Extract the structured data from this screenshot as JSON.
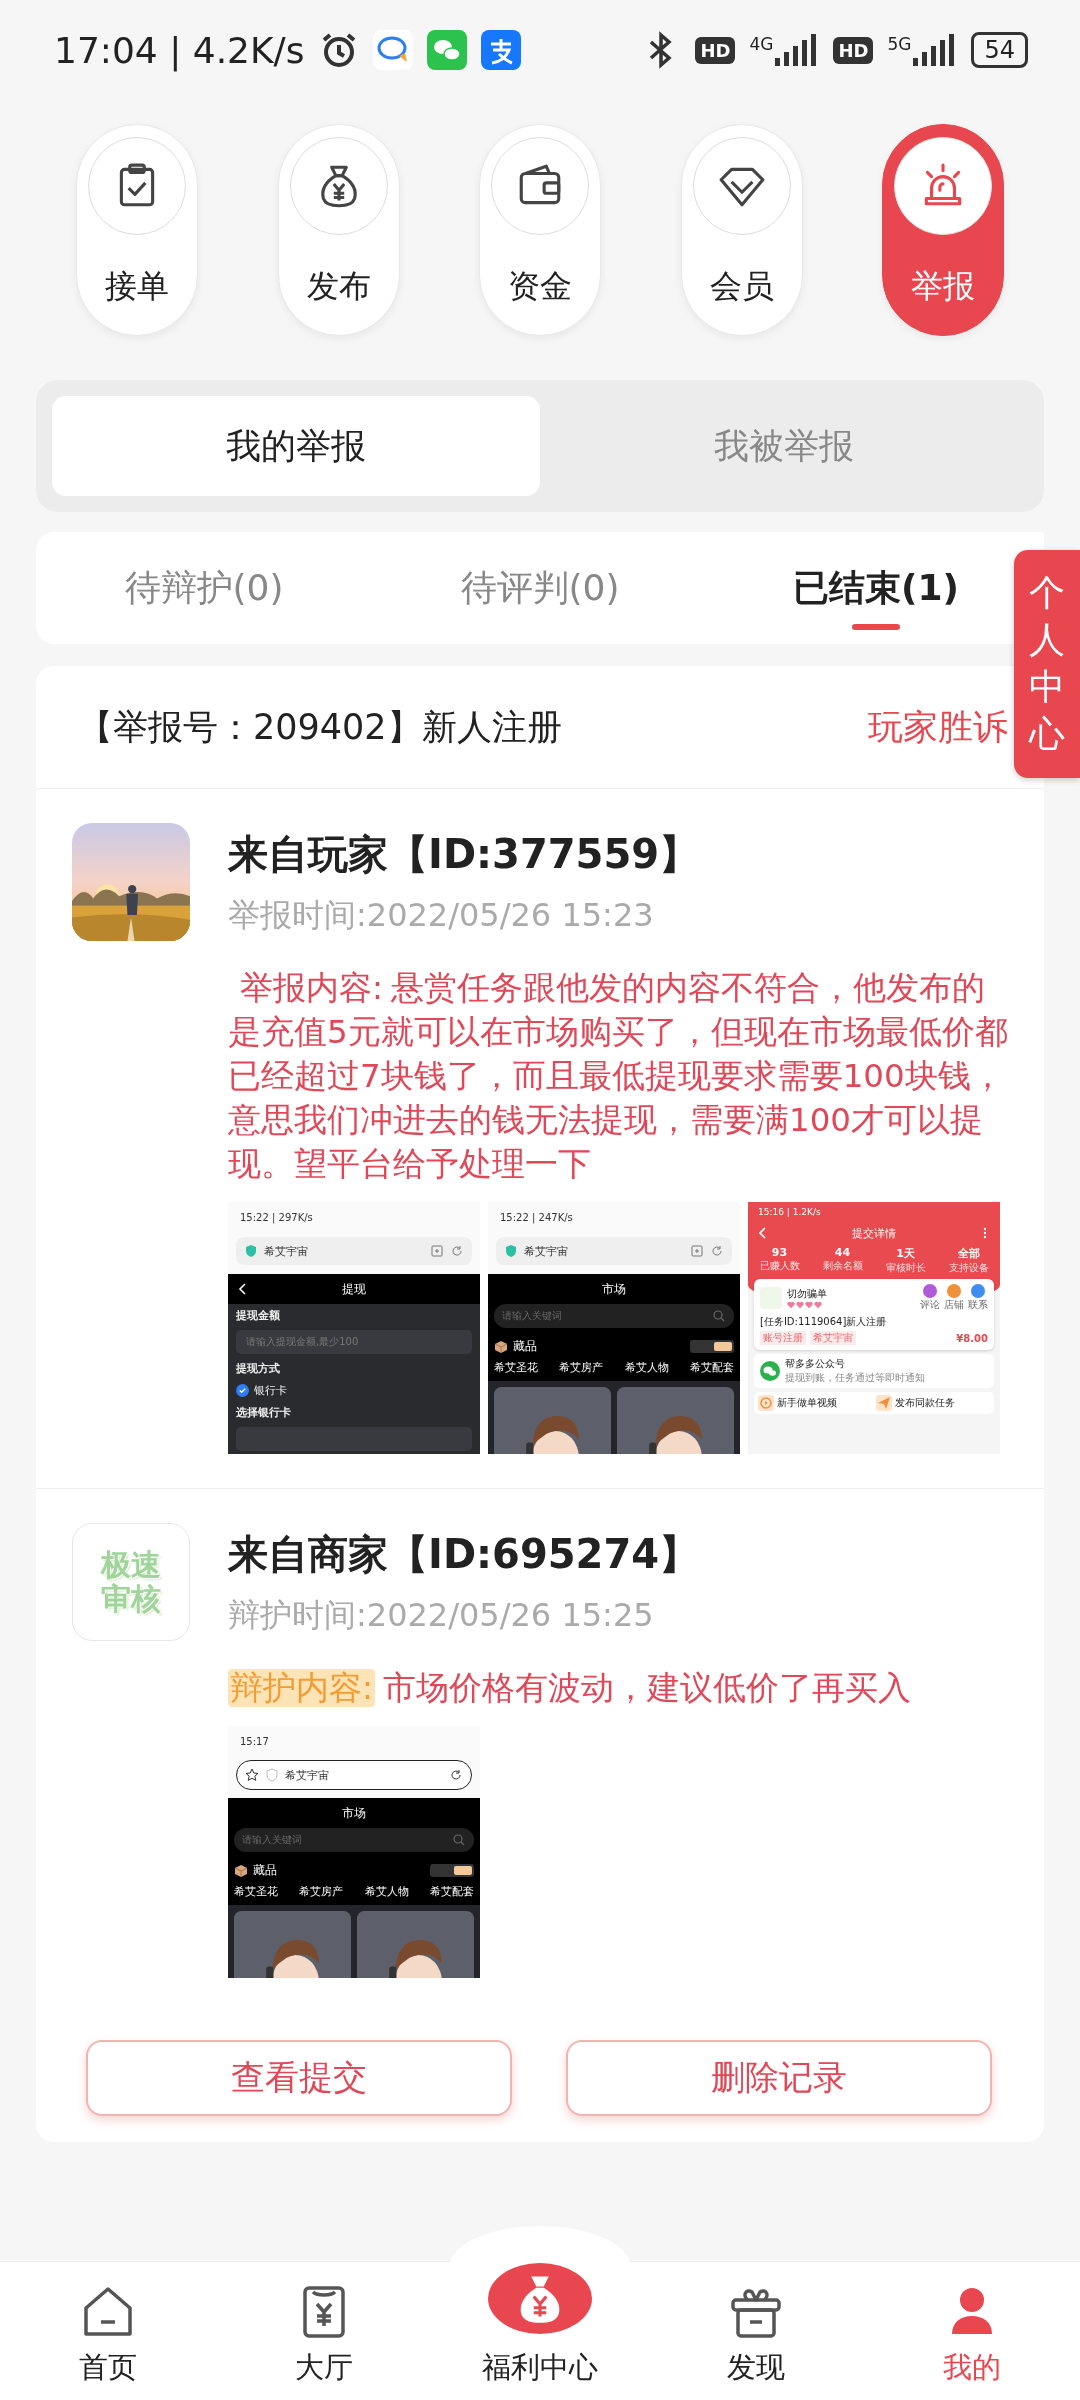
{
  "status_bar": {
    "time": "17:04 | 4.2K/s",
    "networks": [
      {
        "hd": "HD",
        "type": "4G"
      },
      {
        "hd": "HD",
        "type": "5G"
      }
    ],
    "battery": "54"
  },
  "top_actions": [
    {
      "label": "接单",
      "selected": false
    },
    {
      "label": "发布",
      "selected": false
    },
    {
      "label": "资金",
      "selected": false
    },
    {
      "label": "会员",
      "selected": false
    },
    {
      "label": "举报",
      "selected": true
    }
  ],
  "segment_tabs": [
    {
      "label": "我的举报",
      "selected": true
    },
    {
      "label": "我被举报",
      "selected": false
    }
  ],
  "filter_tabs": [
    {
      "label": "待辩护(0)",
      "selected": false
    },
    {
      "label": "待评判(0)",
      "selected": false
    },
    {
      "label": "已结束(1)",
      "selected": true
    }
  ],
  "side_tab": {
    "label": "个人中心"
  },
  "report": {
    "title": "【举报号：209402】新人注册",
    "verdict": "玩家胜诉",
    "entries": [
      {
        "kind": "report",
        "avatar": {
          "kind": "picture"
        },
        "name": "来自玩家【ID:377559】",
        "time": "举报时间:2022/05/26 15:23",
        "content_label": "举报内容:",
        "content": "悬赏任务跟他发的内容不符合，他发布的是充值5元就可以在市场购买了，但现在市场最低价都已经超过7块钱了，而且最低提现要求需要100块钱，意思我们冲进去的钱无法提现，需要满100才可以提现。望平台给予处理一下",
        "screenshots": [
          {
            "kind": "withdraw",
            "status": "15:22 | 297K/s",
            "site": "希艾宇宙",
            "title": "提现",
            "fields": [
              {
                "kind": "label",
                "text": "提现金额"
              },
              {
                "kind": "input",
                "placeholder": "请输入提现金额,最少100"
              },
              {
                "kind": "label",
                "text": "提现方式"
              },
              {
                "kind": "check",
                "text": "银行卡",
                "checked": true
              },
              {
                "kind": "label",
                "text": "选择银行卡"
              },
              {
                "kind": "input"
              }
            ]
          },
          {
            "kind": "market",
            "status": "15:22 | 247K/s",
            "site": "希艾宇宙",
            "title": "市场",
            "search": {
              "placeholder": "请输入关键词"
            },
            "section": "藏品",
            "categories": [
              "希艾圣花",
              "希艾房产",
              "希艾人物",
              "希艾配套"
            ]
          },
          {
            "kind": "details",
            "status": "15:16 | 1.2K/s",
            "title": "提交详情",
            "stats": [
              {
                "value": "93",
                "label": "已赚人数"
              },
              {
                "value": "44",
                "label": "剩余名额"
              },
              {
                "value": "1天",
                "label": "审核时长"
              },
              {
                "value": "全部",
                "label": "支持设备"
              }
            ],
            "task": {
              "name": "切勿骗单",
              "stars": 4,
              "actions": [
                "评论",
                "店铺",
                "联系"
              ],
              "title": "[任务ID:1119064]新人注册",
              "tags": [
                "账号注册",
                "希艾宇宙"
              ],
              "price": "¥8.00"
            },
            "links": [
              {
                "title": "帮多多公众号",
                "subtitle": "提现到账，任务通过等即时通知"
              }
            ],
            "shortcuts": [
              "新手做单视频",
              "发布同款任务"
            ]
          }
        ]
      },
      {
        "kind": "defense",
        "avatar": {
          "kind": "logo",
          "lines": [
            "极速",
            "审核"
          ]
        },
        "name": "来自商家【ID:695274】",
        "time": "辩护时间:2022/05/26 15:25",
        "content_label": "辩护内容:",
        "content": "市场价格有波动，建议低价了再买入",
        "screenshots": [
          {
            "kind": "market",
            "status": "15:17",
            "site": "希艾宇宙",
            "title": "市场",
            "search": {
              "placeholder": "请输入关键词"
            },
            "section": "藏品",
            "categories": [
              "希艾圣花",
              "希艾房产",
              "希艾人物",
              "希艾配套"
            ]
          }
        ]
      }
    ],
    "actions": [
      "查看提交",
      "删除记录"
    ]
  },
  "bottom_nav": [
    {
      "label": "首页",
      "selected": false
    },
    {
      "label": "大厅",
      "selected": false
    },
    {
      "label": "福利中心",
      "selected": false
    },
    {
      "label": "发现",
      "selected": false
    },
    {
      "label": "我的",
      "selected": true
    }
  ]
}
